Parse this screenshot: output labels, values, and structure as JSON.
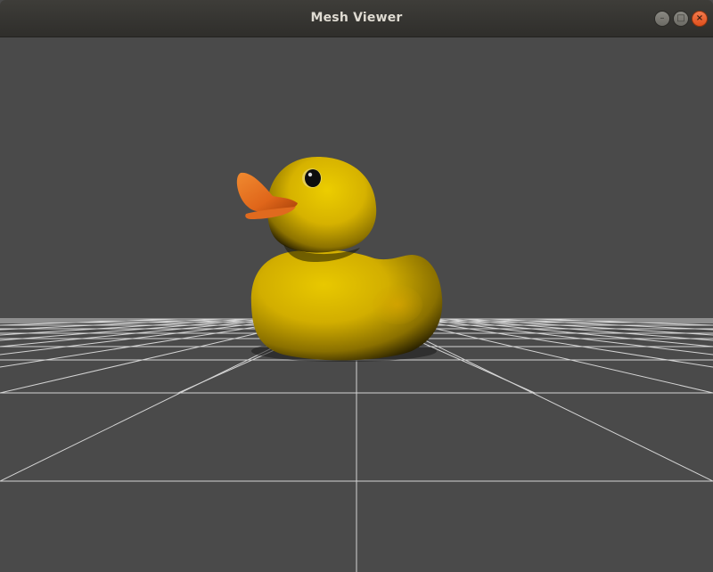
{
  "window": {
    "title": "Mesh Viewer",
    "controls": {
      "minimize_glyph": "–",
      "maximize_glyph": "□",
      "close_glyph": "×"
    }
  },
  "viewport": {
    "background": "#4a4a4a",
    "grid_color": "#d4d4d4",
    "model": {
      "name": "duck",
      "body_color": "#d8b400",
      "shadow_color": "#1e1a00",
      "beak_color": "#e46a1c",
      "eye_color": "#0d0d0d"
    }
  },
  "icons": {
    "minimize": "minimize-icon",
    "maximize": "maximize-icon",
    "close": "close-icon"
  }
}
